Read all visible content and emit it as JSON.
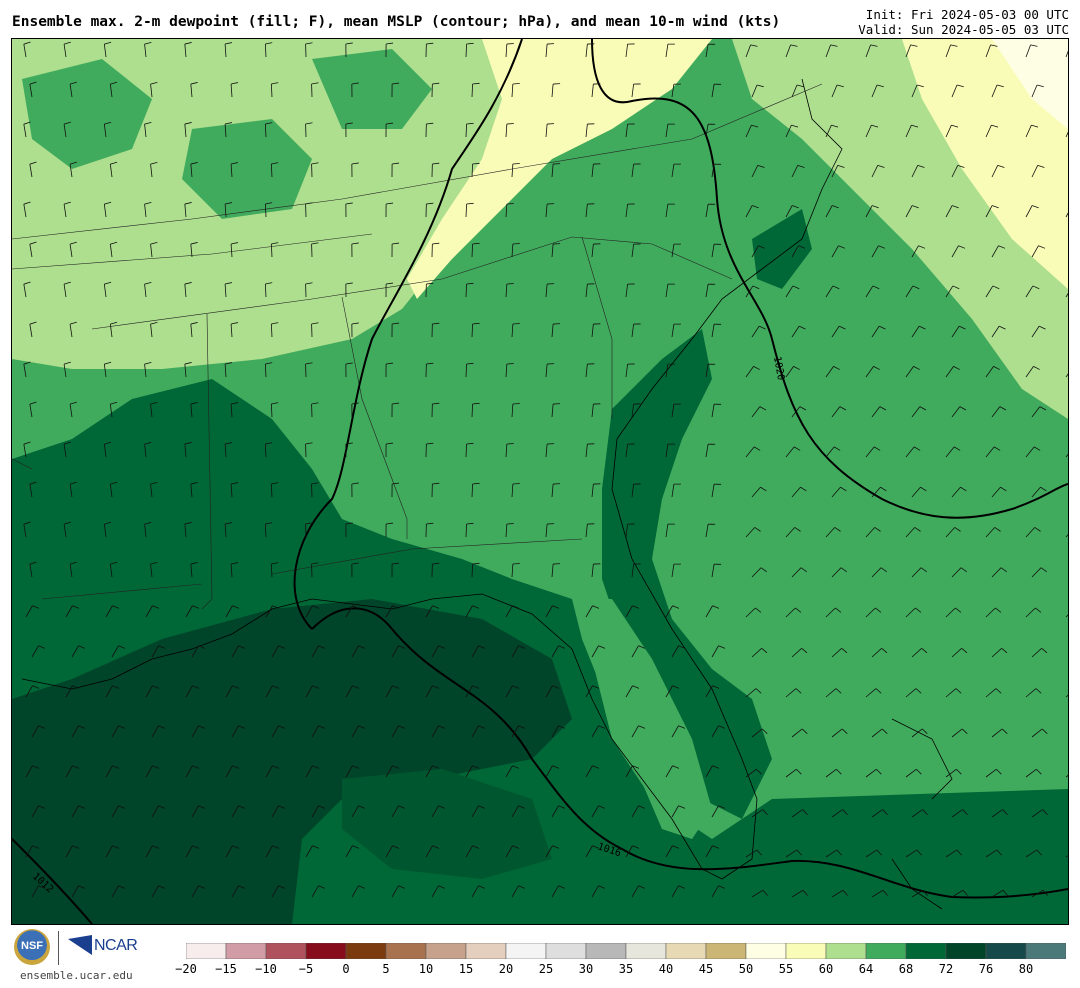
{
  "title": "Ensemble max. 2-m dewpoint (fill; F), mean MSLP (contour; hPa), and mean 10-m wind (kts)",
  "init": "Init: Fri 2024-05-03 00 UTC",
  "valid": "Valid: Sun 2024-05-05 03 UTC",
  "isobars": [
    {
      "label": "1020",
      "value": 1020
    },
    {
      "label": "1016",
      "value": 1016
    },
    {
      "label": "1012",
      "value": 1012
    }
  ],
  "colorbar": {
    "ticks": [
      "−20",
      "−15",
      "−10",
      "−5",
      "0",
      "5",
      "10",
      "15",
      "20",
      "25",
      "30",
      "35",
      "40",
      "45",
      "50",
      "55",
      "60",
      "64",
      "68",
      "72",
      "76",
      "80"
    ],
    "colors": [
      "#f7eded",
      "#d19ca6",
      "#b0525d",
      "#870d1d",
      "#7c3b0e",
      "#a9724f",
      "#c6a18b",
      "#e4cebe",
      "#f4f4f4",
      "#dedede",
      "#b8b8b8",
      "#e6e6dc",
      "#e6d9b4",
      "#cbb676",
      "#fefee4",
      "#f9fcb6",
      "#addf8e",
      "#41ab5d",
      "#006837",
      "#004529",
      "#164a4a",
      "#4b7878"
    ]
  },
  "logos": {
    "nsf": "NSF",
    "ncar": "NCAR",
    "site": "ensemble.ucar.edu"
  }
}
